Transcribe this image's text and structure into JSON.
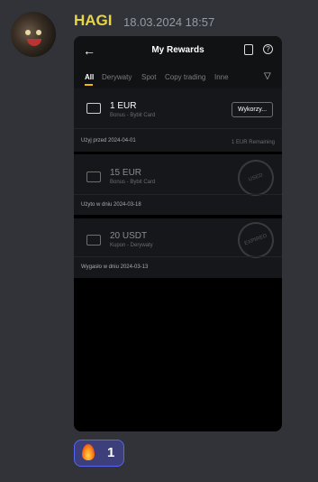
{
  "message": {
    "username": "HAGI",
    "timestamp": "18.03.2024 18:57"
  },
  "app": {
    "title": "My Rewards",
    "tabs": [
      "All",
      "Derywaty",
      "Spot",
      "Copy trading",
      "Inne"
    ],
    "rewards": [
      {
        "amount": "1 EUR",
        "subtitle": "Bonus - Bybit Card",
        "action": "Wykorzy...",
        "status": "Użyj przed 2024-04-01",
        "remaining": "1 EUR Remaining"
      },
      {
        "amount": "15 EUR",
        "subtitle": "Bonus - Bybit Card",
        "status": "Użyto w dniu 2024-03-18",
        "stamp": "USED"
      },
      {
        "amount": "20 USDT",
        "subtitle": "Kupon - Derywaty",
        "status": "Wygasło w dniu 2024-03-13",
        "stamp": "EXPIRED"
      }
    ]
  },
  "reaction": {
    "emoji_name": "fire-emoji",
    "count": "1"
  }
}
